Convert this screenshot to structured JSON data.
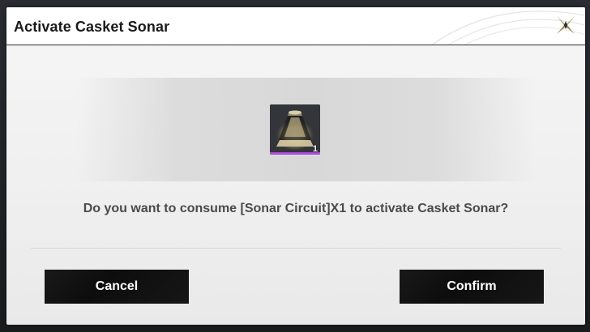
{
  "dialog": {
    "title": "Activate Casket Sonar",
    "close_icon": "close-x-icon",
    "item": {
      "icon": "sonar-circuit-icon",
      "count": "1",
      "rarity_color": "#b04ce0"
    },
    "prompt": "Do you want to consume [Sonar Circuit]X1 to activate Casket Sonar?",
    "buttons": {
      "cancel_label": "Cancel",
      "confirm_label": "Confirm"
    }
  },
  "colors": {
    "button_bg": "#0d0d0d",
    "dialog_bg": "#f2f2f2",
    "accent_gold": "#a08c5a"
  }
}
